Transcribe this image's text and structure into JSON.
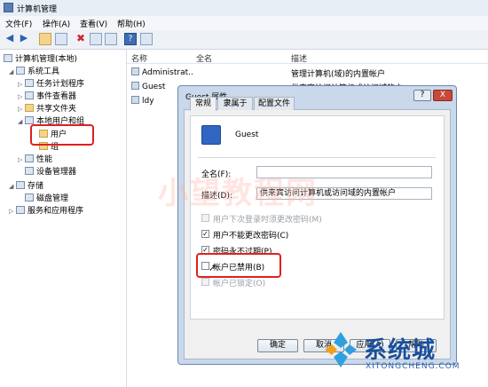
{
  "window": {
    "title": "计算机管理"
  },
  "menu": [
    "文件(F)",
    "操作(A)",
    "查看(V)",
    "帮助(H)"
  ],
  "tree": {
    "root": "计算机管理(本地)",
    "system_tools": "系统工具",
    "task_scheduler": "任务计划程序",
    "event_viewer": "事件查看器",
    "shared_folders": "共享文件夹",
    "local_users_groups": "本地用户和组",
    "users": "用户",
    "groups": "组",
    "performance": "性能",
    "device_manager": "设备管理器",
    "storage": "存储",
    "disk_management": "磁盘管理",
    "services_apps": "服务和应用程序"
  },
  "list": {
    "columns": [
      "名称",
      "全名",
      "描述"
    ],
    "rows": [
      {
        "name": "Administrat...",
        "fullname": "",
        "desc": "管理计算机(域)的内置帐户"
      },
      {
        "name": "Guest",
        "fullname": "",
        "desc": "供来宾访问计算机或访问域的内"
      },
      {
        "name": "ldy",
        "fullname": "",
        "desc": ""
      }
    ]
  },
  "dialog": {
    "title": "Guest 属性",
    "help_btn": "?",
    "close_btn": "X",
    "tabs": [
      "常规",
      "隶属于",
      "配置文件"
    ],
    "username": "Guest",
    "fullname_label": "全名(F):",
    "fullname_value": "",
    "desc_label": "描述(D):",
    "desc_value": "供来宾访问计算机或访问域的内置帐户",
    "checkboxes": [
      {
        "label": "用户下次登录时须更改密码(M)",
        "checked": "",
        "enabled": false
      },
      {
        "label": "用户不能更改密码(C)",
        "checked": "✓",
        "enabled": true
      },
      {
        "label": "密码永不过期(P)",
        "checked": "✓",
        "enabled": true
      },
      {
        "label": "帐户已禁用(B)",
        "checked": "",
        "enabled": true
      },
      {
        "label": "帐户已锁定(O)",
        "checked": "",
        "enabled": false
      }
    ],
    "buttons": [
      "确定",
      "取消",
      "应用(A)",
      "帮助"
    ]
  },
  "watermark": {
    "text": "小望教程网",
    "logo_text": "系统城",
    "logo_url_text": "XITONGCHENG.COM"
  }
}
